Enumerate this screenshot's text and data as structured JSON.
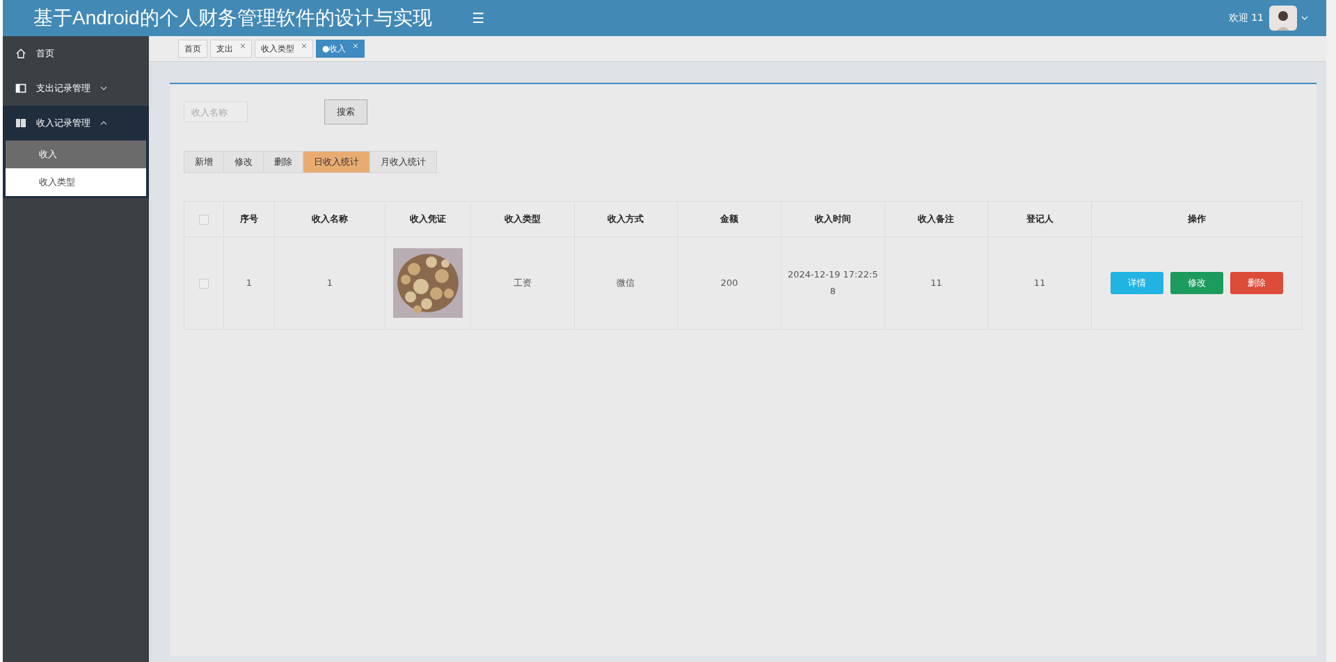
{
  "header": {
    "title": "基于Android的个人财务管理软件的设计与实现",
    "menu_toggle": "☰",
    "welcome": "欢迎 11"
  },
  "sidebar": {
    "items": [
      {
        "label": "首页",
        "expanded": false
      },
      {
        "label": "支出记录管理",
        "expanded": false
      },
      {
        "label": "收入记录管理",
        "expanded": true,
        "children": [
          {
            "label": "收入",
            "selected": true
          },
          {
            "label": "收入类型",
            "selected": false
          }
        ]
      }
    ]
  },
  "tabs": [
    {
      "label": "首页",
      "closable": false,
      "selected": false
    },
    {
      "label": "支出",
      "closable": true,
      "selected": false
    },
    {
      "label": "收入类型",
      "closable": true,
      "selected": false
    },
    {
      "label": "●收入",
      "closable": true,
      "selected": true
    }
  ],
  "search": {
    "placeholder": "收入名称",
    "button": "搜索"
  },
  "toolbar": [
    {
      "label": "新增",
      "highlighted": false
    },
    {
      "label": "修改",
      "highlighted": false
    },
    {
      "label": "删除",
      "highlighted": false
    },
    {
      "label": "日收入统计",
      "highlighted": true
    },
    {
      "label": "月收入统计",
      "highlighted": false
    }
  ],
  "table": {
    "header_checked": false,
    "columns": [
      "序号",
      "收入名称",
      "收入凭证",
      "收入类型",
      "收入方式",
      "金额",
      "收入时间",
      "收入备注",
      "登记人",
      "操作"
    ],
    "rows": [
      {
        "checked": false,
        "cells": [
          "1",
          "1",
          {
            "kind": "picture"
          },
          "工资",
          "微信",
          "200",
          "2024-12-19 17:22:58",
          "11",
          "11"
        ],
        "actions": [
          {
            "label": "详情",
            "kind": "info"
          },
          {
            "label": "修改",
            "kind": "edit"
          },
          {
            "label": "删除",
            "kind": "delete"
          }
        ]
      }
    ]
  }
}
